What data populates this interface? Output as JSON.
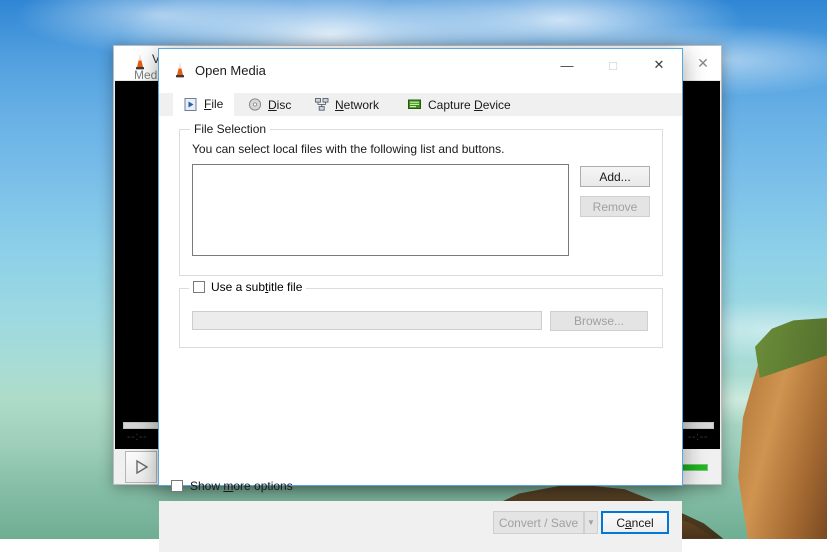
{
  "desktop": {
    "wallpaper_description": "blue sky with clouds over teal sea and sandstone cliffs"
  },
  "vlc_window": {
    "title_fragment": "V",
    "subtitle_fragment": "Medi",
    "icon": "vlc-cone-icon",
    "close_label": "✕",
    "time_left": "--:--",
    "time_right": "--:--",
    "play_icon": "play-icon",
    "volume_icon": "speaker-icon"
  },
  "dialog": {
    "icon": "vlc-cone-icon",
    "title": "Open Media",
    "window_buttons": {
      "minimize": "—",
      "maximize": "□",
      "close": "✕"
    },
    "tabs": [
      {
        "id": "file",
        "label": "File",
        "mnemonic": "F",
        "icon": "file-play-icon",
        "active": true
      },
      {
        "id": "disc",
        "label": "Disc",
        "mnemonic": "D",
        "icon": "disc-icon",
        "active": false
      },
      {
        "id": "network",
        "label": "Network",
        "mnemonic": "N",
        "icon": "network-icon",
        "active": false
      },
      {
        "id": "capture",
        "label": "Capture Device",
        "mnemonic": "D",
        "icon": "capture-card-icon",
        "active": false
      }
    ],
    "file_selection": {
      "group_title": "File Selection",
      "hint": "You can select local files with the following list and buttons.",
      "list_items": [],
      "add_label": "Add...",
      "remove_label": "Remove",
      "remove_enabled": false
    },
    "subtitle": {
      "checkbox_label_pre": "Use a sub",
      "checkbox_mnemonic": "t",
      "checkbox_label_post": "itle file",
      "checked": false,
      "path_value": "",
      "browse_label": "Browse...",
      "browse_enabled": false
    },
    "show_more": {
      "label_pre": "Show ",
      "mnemonic": "m",
      "label_post": "ore options",
      "checked": false
    },
    "footer": {
      "convert_label": "Convert / Save",
      "convert_enabled": false,
      "convert_dropdown_icon": "chevron-down-icon",
      "cancel_label_pre": "C",
      "cancel_mnemonic": "a",
      "cancel_label_post": "ncel",
      "cancel_focused": true
    }
  },
  "colors": {
    "accent": "#0078d7",
    "dialog_border": "#5aa7dd",
    "dialog_bg": "#f0f0f0",
    "body_bg": "#ffffff",
    "disabled_text": "#a0a0a0",
    "volume_green": "#1fbd1f"
  }
}
